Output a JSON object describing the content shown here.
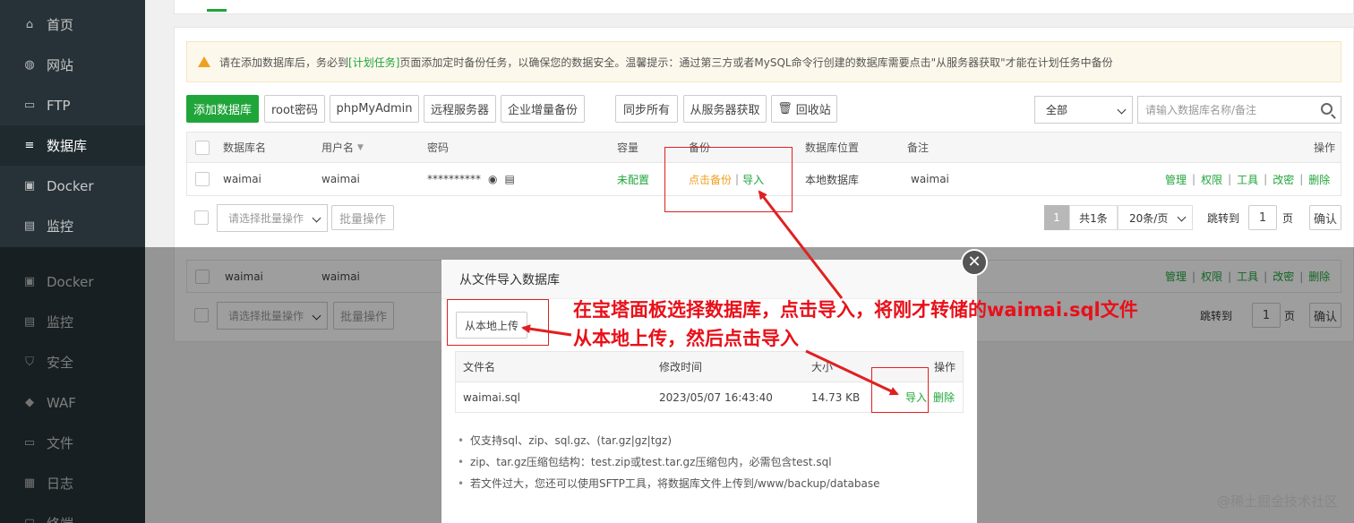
{
  "sidebar_top": [
    {
      "label": "首页",
      "icon": "home-icon"
    },
    {
      "label": "网站",
      "icon": "globe-icon"
    },
    {
      "label": "FTP",
      "icon": "ftp-icon"
    },
    {
      "label": "数据库",
      "icon": "database-icon"
    },
    {
      "label": "Docker",
      "icon": "docker-icon"
    },
    {
      "label": "监控",
      "icon": "monitor-icon"
    }
  ],
  "sidebar_bottom": [
    {
      "label": "Docker",
      "icon": "docker-icon"
    },
    {
      "label": "监控",
      "icon": "monitor-icon"
    },
    {
      "label": "安全",
      "icon": "shield-icon"
    },
    {
      "label": "WAF",
      "icon": "waf-icon"
    },
    {
      "label": "文件",
      "icon": "folder-icon"
    },
    {
      "label": "日志",
      "icon": "log-icon"
    },
    {
      "label": "终端",
      "icon": "terminal-icon"
    }
  ],
  "notice": {
    "prefix": "请在添加数据库后，务必到",
    "link": "[计划任务]",
    "suffix": "页面添加定时备份任务，以确保您的数据安全。温馨提示：通过第三方或者MySQL命令行创建的数据库需要点击\"从服务器获取\"才能在计划任务中备份"
  },
  "toolbar": {
    "add_db": "添加数据库",
    "root_pwd": "root密码",
    "phpmyadmin": "phpMyAdmin",
    "remote_server": "远程服务器",
    "enterprise_backup": "企业增量备份",
    "sync_all": "同步所有",
    "get_from_server": "从服务器获取",
    "recycle_bin": "回收站",
    "filter_value": "全部",
    "search_placeholder": "请输入数据库名称/备注"
  },
  "table": {
    "headers": {
      "name": "数据库名",
      "user": "用户名",
      "password": "密码",
      "capacity": "容量",
      "backup": "备份",
      "location": "数据库位置",
      "note": "备注",
      "action": "操作"
    },
    "row": {
      "name": "waimai",
      "user": "waimai",
      "password": "**********",
      "capacity": "未配置",
      "backup": "点击备份",
      "import": "导入",
      "location": "本地数据库",
      "note": "waimai",
      "actions": [
        "管理",
        "权限",
        "工具",
        "改密",
        "删除"
      ]
    }
  },
  "footer": {
    "batch_placeholder": "请选择批量操作",
    "batch_button": "批量操作",
    "page": "1",
    "total": "共1条",
    "per_page": "20条/页",
    "jump_to": "跳转到",
    "jump_value": "1",
    "page_unit": "页",
    "confirm": "确认"
  },
  "dialog": {
    "title": "从文件导入数据库",
    "upload_button": "从本地上传",
    "headers": {
      "file": "文件名",
      "mtime": "修改时间",
      "size": "大小",
      "action": "操作"
    },
    "file": {
      "name": "waimai.sql",
      "mtime": "2023/05/07 16:43:40",
      "size": "14.73 KB",
      "import": "导入",
      "delete": "删除"
    },
    "notes": [
      "仅支持sql、zip、sql.gz、(tar.gz|gz|tgz)",
      "zip、tar.gz压缩包结构：test.zip或test.tar.gz压缩包内，必需包含test.sql",
      "若文件过大，您还可以使用SFTP工具，将数据库文件上传到/www/backup/database"
    ]
  },
  "annotation": {
    "line1": "在宝塔面板选择数据库，点击导入，将刚才转储的waimai.sql文件",
    "line2": "从本地上传，然后点击导入"
  },
  "watermark": "@稀土掘金技术社区",
  "colors": {
    "accent": "#20a53a",
    "warning": "#f0a020",
    "annotation": "#e8101a",
    "sidebar": "#263238"
  }
}
